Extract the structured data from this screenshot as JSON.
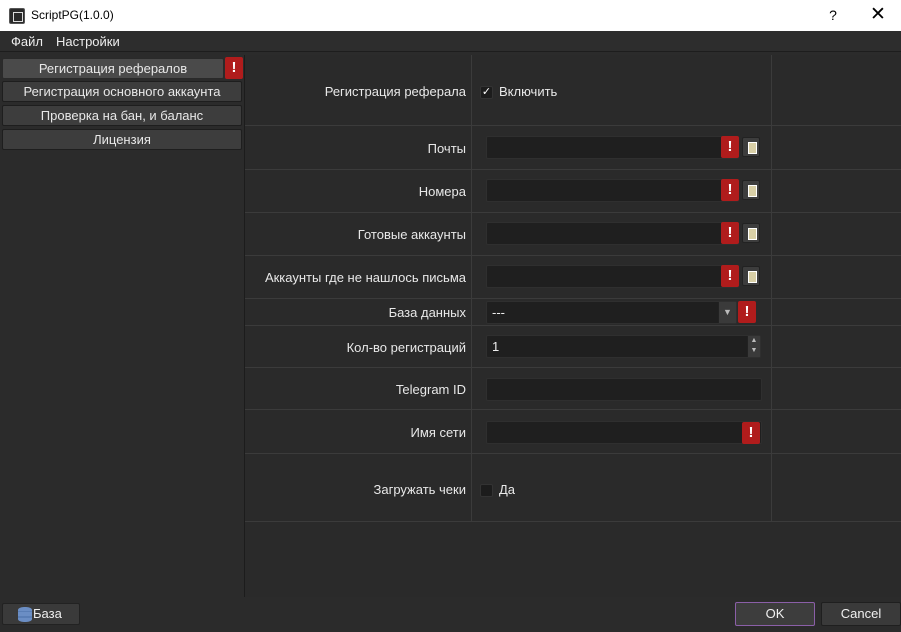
{
  "window": {
    "title": "ScriptPG(1.0.0)",
    "help": "?",
    "close": "✕"
  },
  "menu": {
    "file": "Файл",
    "settings": "Настройки"
  },
  "sidebar": {
    "items": [
      {
        "label": "Регистрация рефералов"
      },
      {
        "label": "Регистрация основного аккаунта"
      },
      {
        "label": "Проверка на бан, и баланс"
      },
      {
        "label": "Лицензия"
      }
    ]
  },
  "form": {
    "referral": {
      "label": "Регистрация реферала",
      "checkbox_label": "Включить",
      "checked": true
    },
    "emails": {
      "label": "Почты",
      "value": ""
    },
    "numbers": {
      "label": "Номера",
      "value": ""
    },
    "ready_accounts": {
      "label": "Готовые аккаунты",
      "value": ""
    },
    "no_email_accounts": {
      "label": "Аккаунты где не нашлось письма",
      "value": ""
    },
    "database": {
      "label": "База данных",
      "value": "---"
    },
    "reg_count": {
      "label": "Кол-во регистраций",
      "value": "1"
    },
    "telegram_id": {
      "label": "Telegram ID",
      "value": ""
    },
    "network_name": {
      "label": "Имя сети",
      "value": ""
    },
    "upload_receipts": {
      "label": "Загружать чеки",
      "checkbox_label": "Да",
      "checked": false
    }
  },
  "warning_glyph": "!",
  "check_glyph": "✓",
  "bottom": {
    "base_label": "База",
    "ok_label": "OK",
    "cancel_label": "Cancel"
  },
  "colors": {
    "warning": "#b01c1c",
    "accent_border": "#8b5fa8"
  }
}
